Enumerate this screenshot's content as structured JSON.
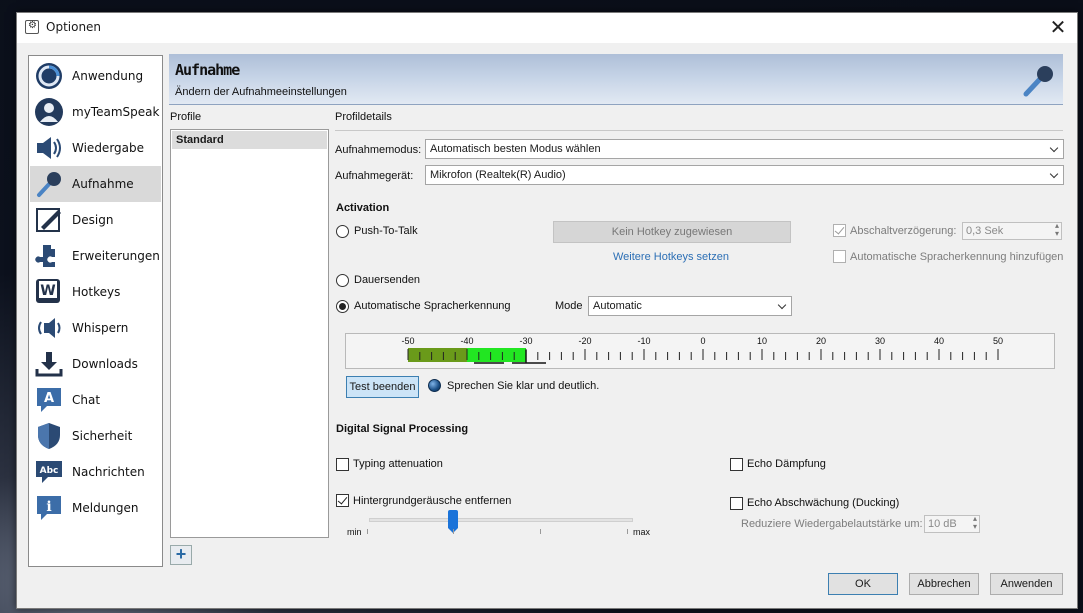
{
  "window": {
    "title": "Optionen",
    "close_glyph": "✕"
  },
  "sidebar": {
    "items": [
      {
        "label": "Anwendung",
        "icon": "application-icon"
      },
      {
        "label": "myTeamSpeak",
        "icon": "user-icon"
      },
      {
        "label": "Wiedergabe",
        "icon": "speaker-icon"
      },
      {
        "label": "Aufnahme",
        "icon": "microphone-icon",
        "selected": true
      },
      {
        "label": "Design",
        "icon": "pencil-icon"
      },
      {
        "label": "Erweiterungen",
        "icon": "puzzle-icon"
      },
      {
        "label": "Hotkeys",
        "icon": "keyboard-key-icon"
      },
      {
        "label": "Whispern",
        "icon": "whisper-icon"
      },
      {
        "label": "Downloads",
        "icon": "download-icon"
      },
      {
        "label": "Chat",
        "icon": "chat-icon"
      },
      {
        "label": "Sicherheit",
        "icon": "shield-icon"
      },
      {
        "label": "Nachrichten",
        "icon": "messages-icon"
      },
      {
        "label": "Meldungen",
        "icon": "info-icon"
      }
    ]
  },
  "header": {
    "title": "Aufnahme",
    "subtitle": "Ändern der Aufnahmeeinstellungen"
  },
  "profiles": {
    "heading": "Profile",
    "items": [
      "Standard"
    ],
    "add_glyph": "+"
  },
  "details": {
    "heading": "Profildetails",
    "mode_label": "Aufnahmemodus:",
    "mode_value": "Automatisch besten Modus wählen",
    "device_label": "Aufnahmegerät:",
    "device_value": "Mikrofon (Realtek(R) Audio)"
  },
  "activation": {
    "heading": "Activation",
    "ptt_label": "Push-To-Talk",
    "hotkey_button": "Kein Hotkey zugewiesen",
    "more_hotkeys_link": "Weitere Hotkeys setzen",
    "delay_label": "Abschaltverzögerung:",
    "delay_value": "0,3 Sek",
    "delay_checked": true,
    "auto_voice_add_label": "Automatische Spracherkennung hinzufügen",
    "continuous_label": "Dauersenden",
    "vad_label": "Automatische Spracherkennung",
    "vad_selected": true,
    "mode_label": "Mode",
    "mode_value": "Automatic"
  },
  "meter": {
    "ticks": [
      "-50",
      "-40",
      "-30",
      "-20",
      "-10",
      "0",
      "10",
      "20",
      "30",
      "50"
    ],
    "ticks_full": [
      "-50",
      "-40",
      "-30",
      "-20",
      "-10",
      "0",
      "10",
      "20",
      "30",
      "40",
      "50"
    ],
    "level_db": -30,
    "colors": {
      "low": "#6a9a1a",
      "high": "#22e622"
    }
  },
  "test": {
    "button": "Test beenden",
    "hint": "Sprechen Sie klar und deutlich."
  },
  "dsp": {
    "heading": "Digital Signal Processing",
    "typing_label": "Typing attenuation",
    "typing_checked": false,
    "echo_damp_label": "Echo Dämpfung",
    "echo_damp_checked": false,
    "noise_label": "Hintergrundgeräusche entfernen",
    "noise_checked": true,
    "slider_min": "min",
    "slider_max": "max",
    "slider_level": 0.3,
    "ducking_label": "Echo Abschwächung (Ducking)",
    "ducking_checked": false,
    "reduce_label": "Reduziere Wiedergabelautstärke um:",
    "reduce_value": "10 dB"
  },
  "buttons": {
    "ok": "OK",
    "cancel": "Abbrechen",
    "apply": "Anwenden"
  }
}
